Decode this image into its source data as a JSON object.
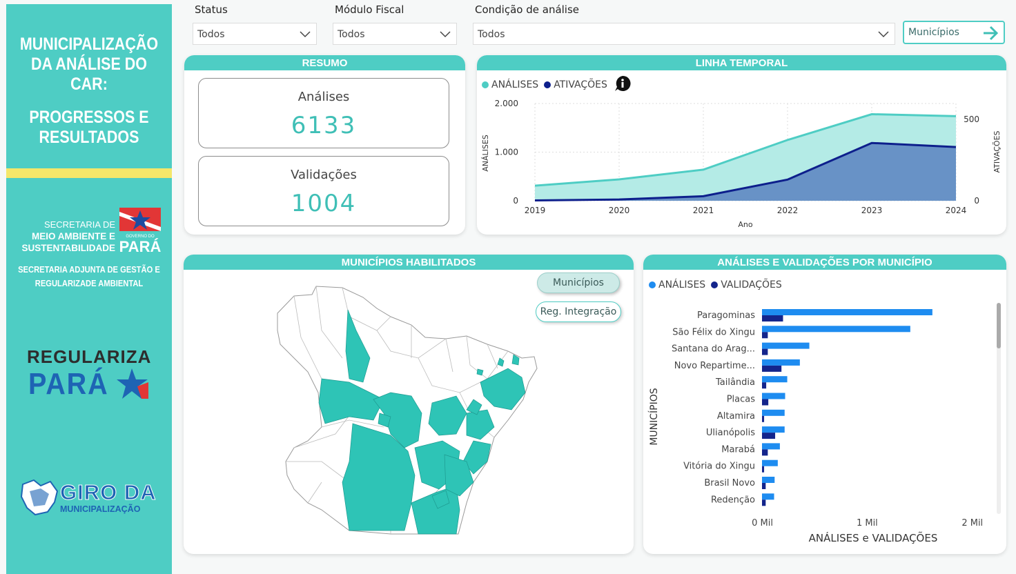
{
  "sidebar": {
    "title_lines": [
      "MUNICIPALIZAÇÃO",
      "DA ANÁLISE DO",
      "CAR:"
    ],
    "subtitle_lines": [
      "PROGRESSOS E",
      "RESULTADOS"
    ],
    "secretaria_line1": "SECRETARIA DE",
    "secretaria_line2": "MEIO AMBIENTE E",
    "secretaria_line3": "SUSTENTABILIDADE",
    "gov_logo_text": "PARÁ",
    "gov_logo_top": "GOVERNO DO",
    "adjunta_line1": "SECRETARIA ADJUNTA DE GESTÃO E",
    "adjunta_line2": "REGULARIZADE AMBIENTAL",
    "regulariza_line1": "REGULARIZA",
    "regulariza_line2": "PARÁ",
    "giro_line1": "GIRO DA",
    "giro_line2": "MUNICIPALIZAÇÃO"
  },
  "filters": {
    "status": {
      "label": "Status",
      "value": "Todos"
    },
    "modulo": {
      "label": "Módulo Fiscal",
      "value": "Todos"
    },
    "condicao": {
      "label": "Condição de análise",
      "value": "Todos"
    },
    "nav_button": "Municípios"
  },
  "resumo": {
    "title": "RESUMO",
    "analises_label": "Análises",
    "analises_value": "6133",
    "validacoes_label": "Validações",
    "validacoes_value": "1004"
  },
  "timeline": {
    "title": "LINHA TEMPORAL",
    "legend": [
      "ANÁLISES",
      "ATIVAÇÕES"
    ],
    "ylabel_left": "ANÁLISES",
    "ylabel_right": "ATIVAÇÕES",
    "xlabel": "Ano",
    "yticks_left": [
      "2.000",
      "1.000",
      "0"
    ],
    "yticks_right": [
      "500",
      "0"
    ],
    "colors": {
      "analises": "#4ecdc4",
      "ativacoes": "#0d1f8c"
    }
  },
  "mapa": {
    "title": "MUNICÍPIOS HABILITADOS",
    "btn_municipios": "Municípios",
    "btn_regiao": "Reg. Integração",
    "habilitado_color": "#2ec4b6"
  },
  "bars": {
    "title": "ANÁLISES E VALIDAÇÕES POR MUNICÍPIO",
    "legend": [
      "ANÁLISES",
      "VALIDAÇÕES"
    ],
    "ylabel": "MUNICÍPIOS",
    "xlabel": "ANÁLISES e VALIDAÇÕES",
    "xticks": [
      "0 Mil",
      "1 Mil",
      "2 Mil"
    ],
    "colors": {
      "analises": "#1e8cf0",
      "validacoes": "#14258c"
    }
  },
  "chart_data": [
    {
      "type": "area",
      "title": "LINHA TEMPORAL",
      "xlabel": "Ano",
      "ylabel": "ANÁLISES",
      "x": [
        "2019",
        "2020",
        "2021",
        "2022",
        "2023",
        "2024"
      ],
      "series": [
        {
          "name": "ANÁLISES",
          "axis": "left",
          "values": [
            310,
            440,
            640,
            1250,
            1780,
            1740
          ]
        },
        {
          "name": "ATIVAÇÕES",
          "axis": "right",
          "values": [
            2,
            8,
            28,
            130,
            355,
            330
          ]
        }
      ],
      "ylim_left": [
        0,
        2000
      ],
      "ylim_right": [
        0,
        500
      ]
    },
    {
      "type": "bar",
      "orientation": "horizontal",
      "title": "ANÁLISES E VALIDAÇÕES POR MUNICÍPIO",
      "xlabel": "ANÁLISES e VALIDAÇÕES",
      "ylabel": "MUNICÍPIOS",
      "categories": [
        "Paragominas",
        "São Félix do Xingu",
        "Santana do Arag...",
        "Novo Repartime...",
        "Tailândia",
        "Placas",
        "Altamira",
        "Ulianópolis",
        "Marabá",
        "Vitória do Xingu",
        "Brasil Novo",
        "Redenção"
      ],
      "series": [
        {
          "name": "ANÁLISES",
          "values": [
            1620,
            1410,
            450,
            360,
            240,
            220,
            215,
            215,
            170,
            150,
            120,
            115
          ]
        },
        {
          "name": "VALIDAÇÕES",
          "values": [
            200,
            55,
            55,
            185,
            40,
            60,
            20,
            125,
            55,
            20,
            35,
            35
          ]
        }
      ],
      "xlim": [
        0,
        2100
      ]
    }
  ]
}
